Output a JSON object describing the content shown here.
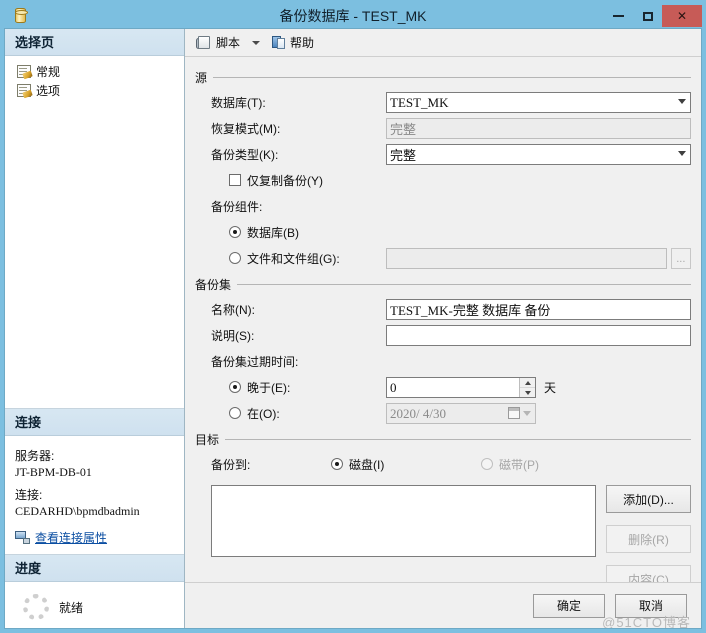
{
  "window": {
    "title": "备份数据库 - TEST_MK",
    "icon": "database-cylinder-icon",
    "minimize_label": "最小化",
    "maximize_label": "最大化",
    "close_label": "关闭",
    "close_glyph": "✕"
  },
  "toolbar": {
    "script_label": "脚本",
    "help_label": "帮助"
  },
  "sidebar": {
    "select_page": {
      "header": "选择页",
      "items": [
        {
          "label": "常规"
        },
        {
          "label": "选项"
        }
      ]
    },
    "connection": {
      "header": "连接",
      "server_label": "服务器:",
      "server_value": "JT-BPM-DB-01",
      "connection_label": "连接:",
      "connection_value": "CEDARHD\\bpmdbadmin",
      "view_properties_link": "查看连接属性"
    },
    "progress": {
      "header": "进度",
      "status": "就绪"
    }
  },
  "source": {
    "group_title": "源",
    "database_label": "数据库(T):",
    "database_value": "TEST_MK",
    "recovery_model_label": "恢复模式(M):",
    "recovery_model_value": "完整",
    "backup_type_label": "备份类型(K):",
    "backup_type_value": "完整",
    "copy_only_label": "仅复制备份(Y)",
    "copy_only_checked": false,
    "component_label": "备份组件:",
    "component_database_label": "数据库(B)",
    "component_files_label": "文件和文件组(G):",
    "component_files_value": "",
    "component_browse_label": "...",
    "selected_component": "database"
  },
  "backup_set": {
    "group_title": "备份集",
    "name_label": "名称(N):",
    "name_value": "TEST_MK-完整 数据库 备份",
    "description_label": "说明(S):",
    "description_value": "",
    "expiration_label": "备份集过期时间:",
    "after_label": "晚于(E):",
    "after_value": "0",
    "days_label": "天",
    "on_label": "在(O):",
    "on_value": "2020/ 4/30",
    "selected_expiration": "after"
  },
  "destination": {
    "group_title": "目标",
    "backup_to_label": "备份到:",
    "disk_label": "磁盘(I)",
    "tape_label": "磁带(P)",
    "selected_media": "disk",
    "list_items": [],
    "add_button": "添加(D)...",
    "remove_button": "删除(R)",
    "contents_button": "内容(C)"
  },
  "footer": {
    "ok_label": "确定",
    "cancel_label": "取消",
    "watermark": "@51CTO博客"
  }
}
